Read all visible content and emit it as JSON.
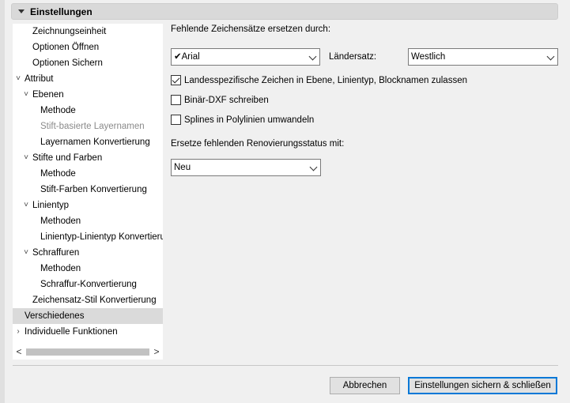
{
  "header": {
    "title": "Einstellungen"
  },
  "tree": {
    "items": [
      {
        "label": "Zeichnungseinheit",
        "level": 1,
        "expander": ""
      },
      {
        "label": "Optionen Öffnen",
        "level": 1,
        "expander": ""
      },
      {
        "label": "Optionen Sichern",
        "level": 1,
        "expander": ""
      },
      {
        "label": "Attribut",
        "level": 0,
        "expander": "expanded"
      },
      {
        "label": "Ebenen",
        "level": 1,
        "expander": "expanded"
      },
      {
        "label": "Methode",
        "level": 2,
        "expander": ""
      },
      {
        "label": "Stift-basierte Layernamen",
        "level": 2,
        "expander": "",
        "disabled": true
      },
      {
        "label": "Layernamen Konvertierung",
        "level": 2,
        "expander": ""
      },
      {
        "label": "Stifte und Farben",
        "level": 1,
        "expander": "expanded"
      },
      {
        "label": "Methode",
        "level": 2,
        "expander": ""
      },
      {
        "label": "Stift-Farben Konvertierung",
        "level": 2,
        "expander": ""
      },
      {
        "label": "Linientyp",
        "level": 1,
        "expander": "expanded"
      },
      {
        "label": "Methoden",
        "level": 2,
        "expander": ""
      },
      {
        "label": "Linientyp-Linientyp Konvertierung",
        "level": 2,
        "expander": ""
      },
      {
        "label": "Schraffuren",
        "level": 1,
        "expander": "expanded"
      },
      {
        "label": "Methoden",
        "level": 2,
        "expander": ""
      },
      {
        "label": "Schraffur-Konvertierung",
        "level": 2,
        "expander": ""
      },
      {
        "label": "Zeichensatz-Stil Konvertierung",
        "level": 1,
        "expander": ""
      },
      {
        "label": "Verschiedenes",
        "level": 0,
        "expander": "",
        "selected": true
      },
      {
        "label": "Individuelle Funktionen",
        "level": 0,
        "expander": "collapsed"
      }
    ]
  },
  "scrollbar": {
    "left_arrow": "<",
    "right_arrow": ">"
  },
  "main": {
    "missing_fonts_label": "Fehlende Zeichensätze ersetzen durch:",
    "font_select_value": "✔Arial",
    "country_label": "Ländersatz:",
    "country_select_value": "Westlich",
    "opt_country_chars": "Landesspezifische Zeichen in Ebene, Linientyp, Blocknamen zulassen",
    "opt_country_chars_checked": true,
    "opt_binary_dxf": "Binär-DXF schreiben",
    "opt_binary_dxf_checked": false,
    "opt_splines": "Splines in Polylinien umwandeln",
    "opt_splines_checked": false,
    "renovation_label": "Ersetze fehlenden Renovierungsstatus mit:",
    "renovation_select_value": "Neu"
  },
  "footer": {
    "cancel_label": "Abbrechen",
    "save_label": "Einstellungen sichern & schließen"
  }
}
